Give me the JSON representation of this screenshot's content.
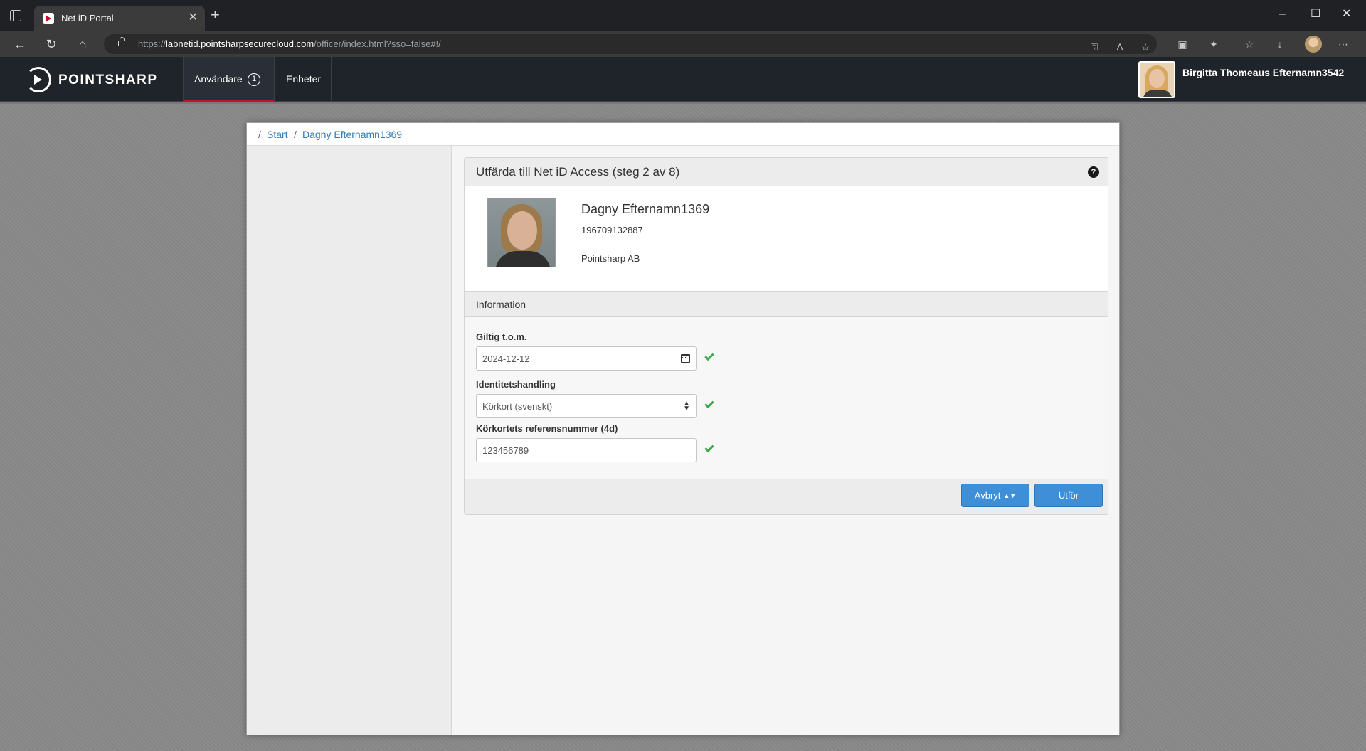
{
  "browser": {
    "tab_title": "Net iD Portal",
    "tab_close": "✕",
    "new_tab": "+",
    "url_scheme": "https://",
    "url_host": "labnetid.pointsharpsecurecloud.com",
    "url_path": "/officer/index.html?sso=false#!/",
    "window_controls": [
      "–",
      "☐",
      "✕"
    ]
  },
  "header": {
    "logo_text": "POINTSHARP",
    "nav": [
      {
        "label": "Användare",
        "badge": "1"
      },
      {
        "label": "Enheter"
      }
    ],
    "user_name": "Birgitta Thomeaus Efternamn3542"
  },
  "breadcrumb": {
    "sep": "/",
    "items": [
      "Start",
      "Dagny Efternamn1369"
    ]
  },
  "card": {
    "title": "Utfärda till Net iD Access (steg 2 av 8)",
    "help": "?",
    "subject": {
      "name": "Dagny Efternamn1369",
      "personal_number": "196709132887",
      "organization": "Pointsharp AB"
    },
    "section_title": "Information",
    "fields": {
      "valid_to": {
        "label": "Giltig t.o.m.",
        "value": "2024-12-12"
      },
      "id_document": {
        "label": "Identitetshandling",
        "value": "Körkort (svenskt)"
      },
      "license_ref": {
        "label": "Körkortets referensnummer (4d)",
        "value": "123456789"
      }
    },
    "buttons": {
      "cancel": "Avbryt",
      "execute": "Utför"
    }
  },
  "colors": {
    "accent_blue": "#3f8fd8",
    "header_bg": "#1f232a",
    "active_tab_indicator": "#c8102e",
    "check_green": "#3cab4a",
    "link": "#337ab7"
  }
}
